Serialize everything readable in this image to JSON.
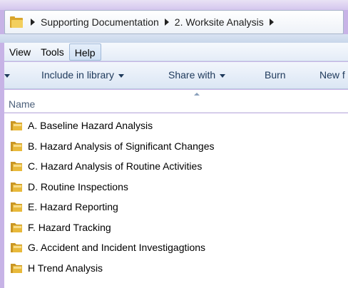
{
  "address_bar": {
    "crumbs": [
      "Supporting Documentation",
      "2. Worksite Analysis"
    ]
  },
  "menu": {
    "items": [
      "View",
      "Tools",
      "Help"
    ],
    "active": "Help"
  },
  "toolbar": {
    "include_label": "Include in library",
    "share_label": "Share with",
    "burn_label": "Burn",
    "new_label": "New f"
  },
  "columns": {
    "name": "Name"
  },
  "files": [
    {
      "name": "A. Baseline Hazard Analysis",
      "icon": "folder-icon"
    },
    {
      "name": "B. Hazard Analysis of Significant Changes",
      "icon": "folder-icon"
    },
    {
      "name": "C. Hazard Analysis of Routine Activities",
      "icon": "folder-icon"
    },
    {
      "name": "D. Routine Inspections",
      "icon": "folder-icon"
    },
    {
      "name": "E. Hazard Reporting",
      "icon": "folder-icon"
    },
    {
      "name": "F. Hazard Tracking",
      "icon": "folder-icon"
    },
    {
      "name": "G. Accident and Incident Investigagtions",
      "icon": "folder-icon"
    },
    {
      "name": "H Trend Analysis",
      "icon": "folder-icon"
    }
  ],
  "colors": {
    "background": "#c7b3e6",
    "toolbar_text": "#1e395b",
    "folder": "#e8b93a"
  }
}
